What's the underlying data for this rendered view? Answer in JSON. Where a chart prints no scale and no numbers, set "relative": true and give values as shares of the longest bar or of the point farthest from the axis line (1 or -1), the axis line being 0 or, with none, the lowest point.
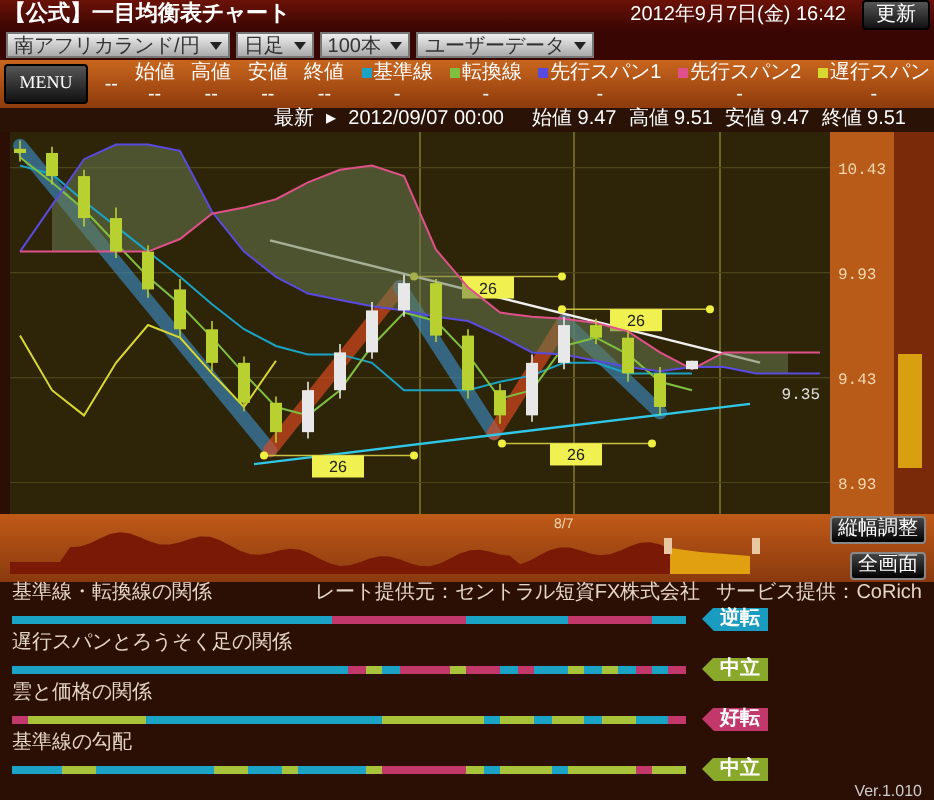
{
  "header": {
    "title": "【公式】一目均衡表チャート",
    "selects": [
      {
        "value": "南アフリカランド/円"
      },
      {
        "value": "日足"
      },
      {
        "value": "100本"
      },
      {
        "value": "ユーザーデータ"
      }
    ],
    "datetime": "2012年9月7日(金) 16:42",
    "update_button": "更新"
  },
  "toolbar": {
    "menu_button": "MENU",
    "placeholder": "--",
    "price_fields": [
      {
        "label": "始値",
        "value": "--"
      },
      {
        "label": "高値",
        "value": "--"
      },
      {
        "label": "安値",
        "value": "--"
      },
      {
        "label": "終値",
        "value": "--"
      }
    ],
    "legend": [
      {
        "label": "基準線",
        "color": "#1aa3c4",
        "value": "-"
      },
      {
        "label": "転換線",
        "color": "#7fbf3f",
        "value": "-"
      },
      {
        "label": "先行スパン1",
        "color": "#5a4be0",
        "value": "-"
      },
      {
        "label": "先行スパン2",
        "color": "#e0508a",
        "value": "-"
      },
      {
        "label": "遅行スパン",
        "color": "#d8d830",
        "value": "-"
      }
    ]
  },
  "latest": {
    "label": "最新",
    "marker": "▸",
    "datetime": "2012/09/07 00:00",
    "quotes": [
      {
        "label": "始値",
        "value": "9.47"
      },
      {
        "label": "高値",
        "value": "9.51"
      },
      {
        "label": "安値",
        "value": "9.47"
      },
      {
        "label": "終値",
        "value": "9.51"
      }
    ]
  },
  "chart": {
    "current_price": "9.35",
    "period_labels": [
      "26",
      "26",
      "26",
      "26"
    ],
    "chart_data": {
      "type": "candlestick",
      "ylim": [
        8.78,
        10.6
      ],
      "yticks": [
        10.43,
        9.93,
        9.43,
        8.93
      ],
      "ohlc": [
        [
          10.52,
          10.56,
          10.46,
          10.5
        ],
        [
          10.5,
          10.53,
          10.35,
          10.39
        ],
        [
          10.39,
          10.42,
          10.15,
          10.19
        ],
        [
          10.19,
          10.24,
          10.0,
          10.03
        ],
        [
          10.03,
          10.06,
          9.81,
          9.85
        ],
        [
          9.85,
          9.9,
          9.62,
          9.66
        ],
        [
          9.66,
          9.7,
          9.46,
          9.5
        ],
        [
          9.5,
          9.53,
          9.27,
          9.31
        ],
        [
          9.31,
          9.34,
          9.12,
          9.17
        ],
        [
          9.17,
          9.41,
          9.14,
          9.37
        ],
        [
          9.37,
          9.59,
          9.33,
          9.55
        ],
        [
          9.55,
          9.79,
          9.52,
          9.75
        ],
        [
          9.75,
          9.92,
          9.72,
          9.88
        ],
        [
          9.88,
          9.9,
          9.6,
          9.63
        ],
        [
          9.63,
          9.66,
          9.33,
          9.37
        ],
        [
          9.37,
          9.4,
          9.21,
          9.25
        ],
        [
          9.25,
          9.54,
          9.22,
          9.5
        ],
        [
          9.5,
          9.72,
          9.47,
          9.68
        ],
        [
          9.68,
          9.71,
          9.59,
          9.62
        ],
        [
          9.62,
          9.65,
          9.41,
          9.45
        ],
        [
          9.45,
          9.48,
          9.25,
          9.29
        ],
        [
          9.47,
          9.51,
          9.47,
          9.51
        ],
        null,
        null,
        null,
        null
      ]
    },
    "indicators": {
      "chart_data": {
        "type": "line",
        "relative": true,
        "grid": true,
        "ylim": [
          8.78,
          10.6
        ],
        "series": [
          {
            "color": "#1aa3c4",
            "values": [
              10.44,
              10.4,
              10.27,
              10.15,
              10.03,
              9.91,
              9.78,
              9.66,
              9.58,
              9.54,
              9.54,
              9.5,
              9.37,
              9.37,
              9.37,
              9.41,
              9.44,
              9.5,
              9.5,
              9.45,
              9.45,
              9.45,
              null,
              null,
              null,
              null
            ]
          },
          {
            "color": "#7fbf3f",
            "values": [
              10.48,
              10.36,
              10.23,
              10.07,
              9.91,
              9.78,
              9.62,
              9.45,
              9.29,
              9.25,
              9.37,
              9.58,
              9.74,
              9.7,
              9.54,
              9.33,
              9.37,
              9.58,
              9.62,
              9.54,
              9.41,
              9.37,
              null,
              null,
              null,
              null
            ]
          },
          {
            "color": "#5a4be0",
            "values": [
              10.03,
              10.25,
              10.47,
              10.54,
              10.54,
              10.51,
              10.22,
              10.03,
              9.91,
              9.83,
              9.8,
              9.77,
              9.75,
              9.72,
              9.7,
              9.63,
              9.55,
              9.54,
              9.51,
              9.48,
              9.46,
              9.48,
              9.48,
              9.45,
              9.45,
              9.45
            ]
          },
          {
            "color": "#e0508a",
            "values": [
              10.03,
              10.03,
              10.03,
              10.03,
              10.03,
              10.09,
              10.21,
              10.24,
              10.28,
              10.36,
              10.42,
              10.44,
              10.39,
              10.04,
              9.86,
              9.74,
              9.72,
              9.71,
              9.69,
              9.65,
              9.55,
              9.47,
              9.55,
              9.55,
              9.55,
              9.55
            ]
          },
          {
            "color": "#d8d830",
            "values": [
              9.63,
              9.37,
              9.25,
              9.5,
              9.68,
              9.62,
              9.45,
              9.29,
              9.51,
              null,
              null,
              null,
              null,
              null,
              null,
              null,
              null,
              null,
              null,
              null,
              null,
              null,
              null,
              null,
              null,
              null
            ]
          }
        ]
      }
    }
  },
  "navigator": {
    "date_label": "8/7",
    "buttons": [
      "縦幅調整",
      "全画面"
    ]
  },
  "credits": {
    "rate_provider": "レート提供元：セントラル短資FX株式会社",
    "service": "サービス提供：CoRich"
  },
  "signals": [
    {
      "label": "基準線・転換線の関係",
      "status": "逆転",
      "color": "#1a9cc0",
      "segments": [
        {
          "color": "#1aa3c4"
        },
        {
          "color": "#1aa3c4"
        },
        {
          "color": "#1aa3c4"
        },
        {
          "color": "#1aa3c4"
        },
        {
          "color": "#1aa3c4"
        },
        {
          "color": "#1aa3c4"
        },
        {
          "color": "#1aa3c4"
        },
        {
          "color": "#1aa3c4"
        },
        {
          "color": "#1aa3c4"
        },
        {
          "color": "#1aa3c4"
        },
        {
          "color": "#1aa3c4"
        },
        {
          "color": "#1aa3c4"
        },
        {
          "color": "#1aa3c4"
        },
        {
          "color": "#1aa3c4"
        },
        {
          "color": "#1aa3c4"
        },
        {
          "color": "#1aa3c4"
        },
        {
          "color": "#1aa3c4"
        },
        {
          "color": "#1aa3c4"
        },
        {
          "color": "#1aa3c4"
        },
        {
          "color": "#c2386a"
        },
        {
          "color": "#c2386a"
        },
        {
          "color": "#c2386a"
        },
        {
          "color": "#c2386a"
        },
        {
          "color": "#c2386a"
        },
        {
          "color": "#c2386a"
        },
        {
          "color": "#c2386a"
        },
        {
          "color": "#c2386a"
        },
        {
          "color": "#1aa3c4"
        },
        {
          "color": "#1aa3c4"
        },
        {
          "color": "#1aa3c4"
        },
        {
          "color": "#1aa3c4"
        },
        {
          "color": "#1aa3c4"
        },
        {
          "color": "#1aa3c4"
        },
        {
          "color": "#c2386a"
        },
        {
          "color": "#c2386a"
        },
        {
          "color": "#c2386a"
        },
        {
          "color": "#c2386a"
        },
        {
          "color": "#c2386a"
        },
        {
          "color": "#1aa3c4"
        },
        {
          "color": "#1aa3c4"
        }
      ]
    },
    {
      "label": "遅行スパンとろうそく足の関係",
      "status": "中立",
      "color": "#8aa82a",
      "segments": [
        {
          "color": "#1aa3c4"
        },
        {
          "color": "#1aa3c4"
        },
        {
          "color": "#1aa3c4"
        },
        {
          "color": "#1aa3c4"
        },
        {
          "color": "#1aa3c4"
        },
        {
          "color": "#1aa3c4"
        },
        {
          "color": "#1aa3c4"
        },
        {
          "color": "#1aa3c4"
        },
        {
          "color": "#1aa3c4"
        },
        {
          "color": "#1aa3c4"
        },
        {
          "color": "#1aa3c4"
        },
        {
          "color": "#1aa3c4"
        },
        {
          "color": "#1aa3c4"
        },
        {
          "color": "#1aa3c4"
        },
        {
          "color": "#1aa3c4"
        },
        {
          "color": "#1aa3c4"
        },
        {
          "color": "#1aa3c4"
        },
        {
          "color": "#1aa3c4"
        },
        {
          "color": "#1aa3c4"
        },
        {
          "color": "#1aa3c4"
        },
        {
          "color": "#c2386a"
        },
        {
          "color": "#a8c23a"
        },
        {
          "color": "#1aa3c4"
        },
        {
          "color": "#c2386a"
        },
        {
          "color": "#c2386a"
        },
        {
          "color": "#c2386a"
        },
        {
          "color": "#a8c23a"
        },
        {
          "color": "#c2386a"
        },
        {
          "color": "#c2386a"
        },
        {
          "color": "#1aa3c4"
        },
        {
          "color": "#c2386a"
        },
        {
          "color": "#1aa3c4"
        },
        {
          "color": "#1aa3c4"
        },
        {
          "color": "#a8c23a"
        },
        {
          "color": "#1aa3c4"
        },
        {
          "color": "#a8c23a"
        },
        {
          "color": "#1aa3c4"
        },
        {
          "color": "#c2386a"
        },
        {
          "color": "#1aa3c4"
        },
        {
          "color": "#c2386a"
        }
      ]
    },
    {
      "label": "雲と価格の関係",
      "status": "好転",
      "color": "#c2386a",
      "segments": [
        {
          "color": "#c2386a"
        },
        {
          "color": "#a8c23a"
        },
        {
          "color": "#a8c23a"
        },
        {
          "color": "#a8c23a"
        },
        {
          "color": "#a8c23a"
        },
        {
          "color": "#a8c23a"
        },
        {
          "color": "#a8c23a"
        },
        {
          "color": "#a8c23a"
        },
        {
          "color": "#1aa3c4"
        },
        {
          "color": "#1aa3c4"
        },
        {
          "color": "#1aa3c4"
        },
        {
          "color": "#1aa3c4"
        },
        {
          "color": "#1aa3c4"
        },
        {
          "color": "#1aa3c4"
        },
        {
          "color": "#1aa3c4"
        },
        {
          "color": "#1aa3c4"
        },
        {
          "color": "#1aa3c4"
        },
        {
          "color": "#1aa3c4"
        },
        {
          "color": "#1aa3c4"
        },
        {
          "color": "#1aa3c4"
        },
        {
          "color": "#1aa3c4"
        },
        {
          "color": "#1aa3c4"
        },
        {
          "color": "#a8c23a"
        },
        {
          "color": "#a8c23a"
        },
        {
          "color": "#a8c23a"
        },
        {
          "color": "#a8c23a"
        },
        {
          "color": "#a8c23a"
        },
        {
          "color": "#a8c23a"
        },
        {
          "color": "#1aa3c4"
        },
        {
          "color": "#a8c23a"
        },
        {
          "color": "#a8c23a"
        },
        {
          "color": "#1aa3c4"
        },
        {
          "color": "#a8c23a"
        },
        {
          "color": "#a8c23a"
        },
        {
          "color": "#1aa3c4"
        },
        {
          "color": "#a8c23a"
        },
        {
          "color": "#a8c23a"
        },
        {
          "color": "#1aa3c4"
        },
        {
          "color": "#1aa3c4"
        },
        {
          "color": "#c2386a"
        }
      ]
    },
    {
      "label": "基準線の勾配",
      "status": "中立",
      "color": "#8aa82a",
      "segments": [
        {
          "color": "#1aa3c4"
        },
        {
          "color": "#1aa3c4"
        },
        {
          "color": "#1aa3c4"
        },
        {
          "color": "#a8c23a"
        },
        {
          "color": "#a8c23a"
        },
        {
          "color": "#1aa3c4"
        },
        {
          "color": "#1aa3c4"
        },
        {
          "color": "#1aa3c4"
        },
        {
          "color": "#1aa3c4"
        },
        {
          "color": "#1aa3c4"
        },
        {
          "color": "#1aa3c4"
        },
        {
          "color": "#1aa3c4"
        },
        {
          "color": "#a8c23a"
        },
        {
          "color": "#a8c23a"
        },
        {
          "color": "#1aa3c4"
        },
        {
          "color": "#1aa3c4"
        },
        {
          "color": "#a8c23a"
        },
        {
          "color": "#1aa3c4"
        },
        {
          "color": "#1aa3c4"
        },
        {
          "color": "#1aa3c4"
        },
        {
          "color": "#1aa3c4"
        },
        {
          "color": "#a8c23a"
        },
        {
          "color": "#c2386a"
        },
        {
          "color": "#c2386a"
        },
        {
          "color": "#c2386a"
        },
        {
          "color": "#c2386a"
        },
        {
          "color": "#c2386a"
        },
        {
          "color": "#a8c23a"
        },
        {
          "color": "#1aa3c4"
        },
        {
          "color": "#a8c23a"
        },
        {
          "color": "#a8c23a"
        },
        {
          "color": "#a8c23a"
        },
        {
          "color": "#1aa3c4"
        },
        {
          "color": "#a8c23a"
        },
        {
          "color": "#a8c23a"
        },
        {
          "color": "#a8c23a"
        },
        {
          "color": "#a8c23a"
        },
        {
          "color": "#c2386a"
        },
        {
          "color": "#a8c23a"
        },
        {
          "color": "#a8c23a"
        }
      ]
    }
  ],
  "version": "Ver.1.010"
}
